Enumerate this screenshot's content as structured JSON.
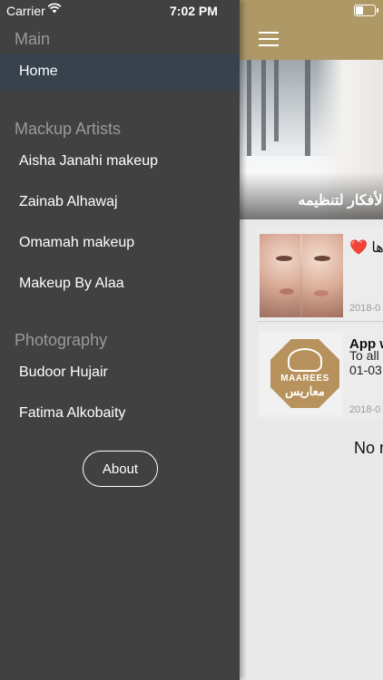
{
  "status_bar": {
    "carrier": "Carrier",
    "time": "7:02 PM"
  },
  "drawer": {
    "sections": [
      {
        "title": "Main",
        "items": [
          "Home"
        ]
      },
      {
        "title": "Mackup Artists",
        "items": [
          "Aisha Janahi makeup",
          "Zainab Alhawaj",
          "Omamah makeup",
          "Makeup By Alaa"
        ]
      },
      {
        "title": "Photography",
        "items": [
          "Budoor Hujair",
          "Fatima Alkobaity"
        ]
      }
    ],
    "selected_item": "Home",
    "about_label": "About"
  },
  "main": {
    "hero_caption": "بعض الأفكار لتنظيمه",
    "cards": [
      {
        "title": "❤️ ها",
        "subtitle": "",
        "date": "2018-0"
      },
      {
        "title": "App w",
        "subtitle": "To all",
        "subtitle2": "01-03",
        "date": "2018-0",
        "logo_latin": "MAAREES",
        "logo_arabic": "معاريس"
      }
    ],
    "empty_text": "No r"
  },
  "colors": {
    "drawer_bg": "#414141",
    "selected_bg": "#37424d",
    "navbar": "#ad9866",
    "logo": "#b8925d"
  }
}
